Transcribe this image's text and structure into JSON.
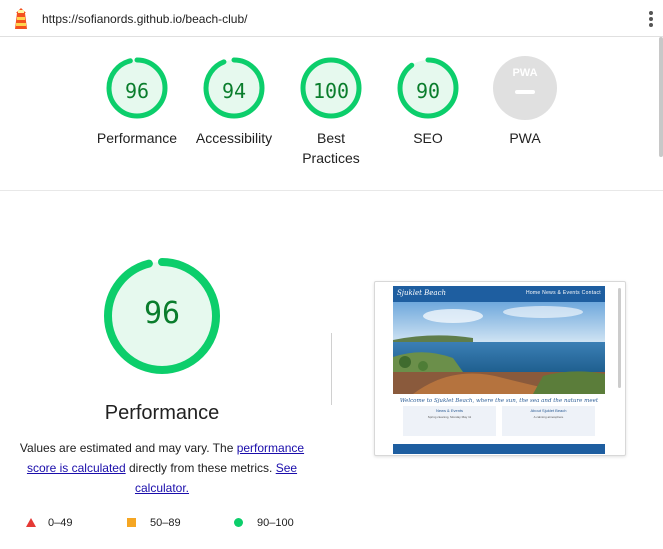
{
  "header": {
    "url": "https://sofianords.github.io/beach-club/",
    "app_icon": "lighthouse-icon",
    "menu_icon": "kebab-menu-icon"
  },
  "colors": {
    "pass": "#0cce6b",
    "pass_text": "#0a7d2c",
    "pass_fill": "#e6f9ee",
    "average": "#f5a623",
    "fail": "#e53935",
    "na": "#e0e0e0"
  },
  "categories": [
    {
      "id": "performance",
      "score": "96",
      "label": "Performance",
      "fraction": 0.96
    },
    {
      "id": "accessibility",
      "score": "94",
      "label": "Accessibility",
      "fraction": 0.94
    },
    {
      "id": "best-practices",
      "score": "100",
      "label_line1": "Best",
      "label_line2": "Practices",
      "fraction": 1.0
    },
    {
      "id": "seo",
      "score": "90",
      "label": "SEO",
      "fraction": 0.9
    },
    {
      "id": "pwa",
      "badge": "PWA",
      "label": "PWA"
    }
  ],
  "performance": {
    "score": "96",
    "fraction": 0.96,
    "title": "Performance",
    "desc_prefix": "Values are estimated and may vary. The ",
    "desc_link1": "performance score is calculated",
    "desc_middle": " directly from these metrics. ",
    "desc_link2": "See calculator."
  },
  "screenshot": {
    "brand": "Sjuklet Beach",
    "nav": "Home  News & Events  Contact",
    "welcome": "Welcome to Sjuklet Beach, where the sun, the sea and the nature meet",
    "col1_title": "News & Events",
    "col1_text": "Spring cleaning, Monday May 11",
    "col2_title": "About Sjuklet Beach",
    "col2_text": "A calming atmosphere"
  },
  "legend": {
    "fail": "0–49",
    "average": "50–89",
    "pass": "90–100"
  }
}
